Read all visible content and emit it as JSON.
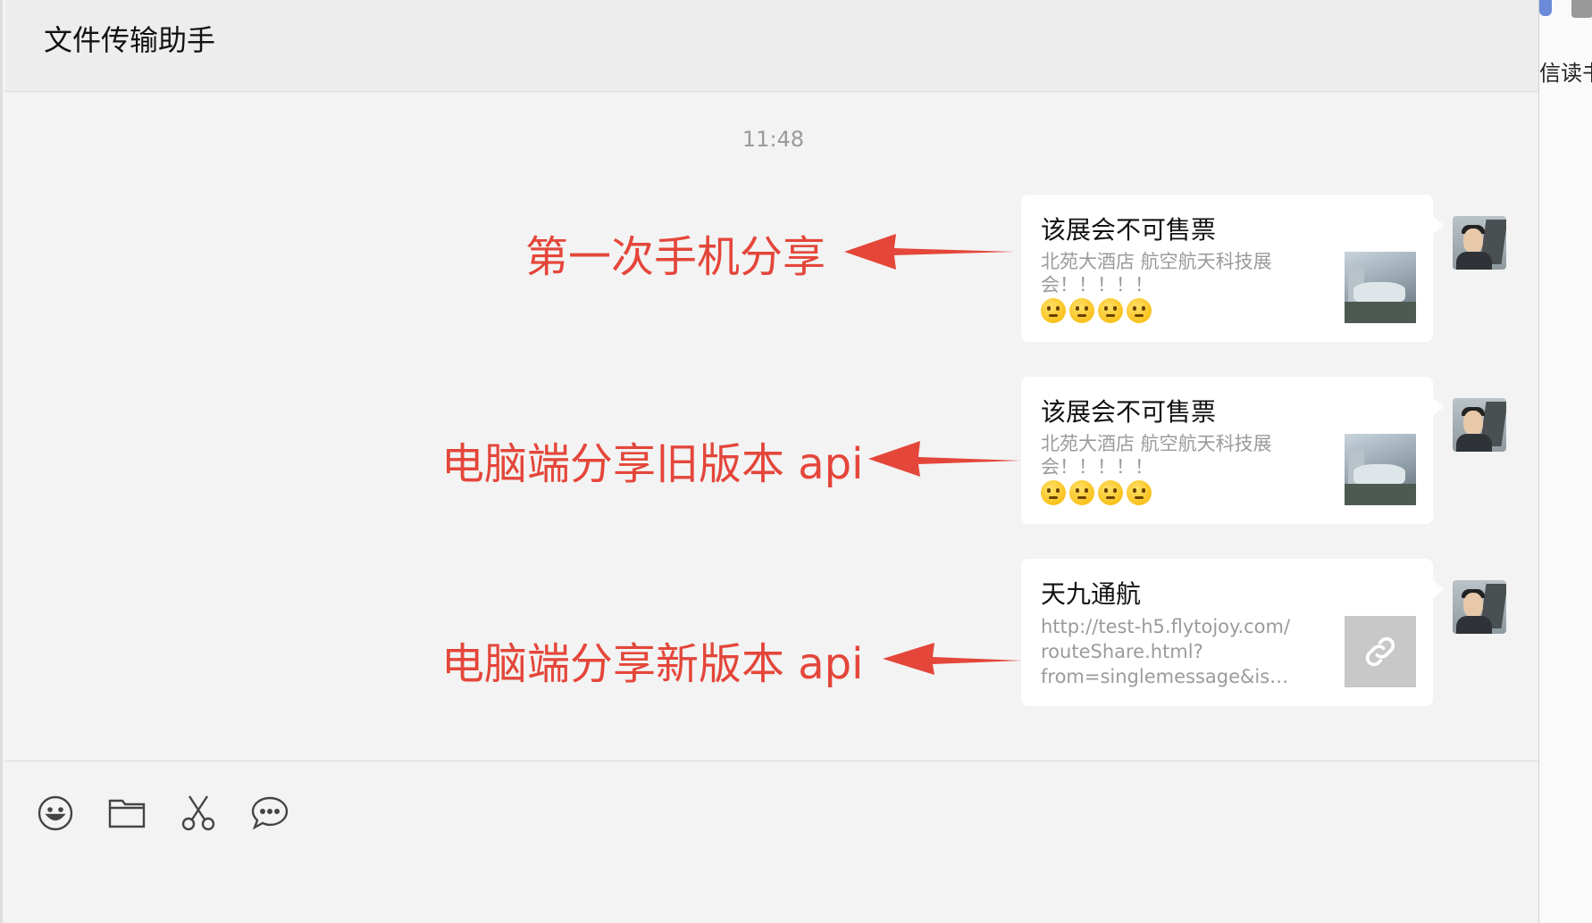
{
  "window": {
    "title": "文件传输助手"
  },
  "conversation": {
    "timestamp": "11:48",
    "messages": [
      {
        "title": "该展会不可售票",
        "desc_line1": "北苑大酒店 航空航天科技展",
        "desc_line2": "会！！！！！",
        "emoji_count": 4,
        "thumbnail": "photo",
        "annotation": "第一次手机分享"
      },
      {
        "title": "该展会不可售票",
        "desc_line1": "北苑大酒店 航空航天科技展",
        "desc_line2": "会！！！！！",
        "emoji_count": 4,
        "thumbnail": "photo",
        "annotation": "电脑端分享旧版本 api"
      },
      {
        "title": "天九通航",
        "desc_line1": "http://test-h5.flytojoy.com/",
        "desc_line2": "routeShare.html?",
        "desc_line3": "from=singlemessage&isappi...",
        "thumbnail": "link-icon",
        "annotation": "电脑端分享新版本 api"
      }
    ]
  },
  "toolbar": {
    "icons": [
      "emoji-icon",
      "folder-icon",
      "scissors-icon",
      "chat-bubble-icon"
    ]
  },
  "right_panel": {
    "partial_text": "信读书"
  },
  "colors": {
    "annotation": "#e4463a",
    "background": "#f3f3f3",
    "header": "#ededed",
    "card": "#ffffff",
    "muted_text": "#9b9b9b"
  }
}
